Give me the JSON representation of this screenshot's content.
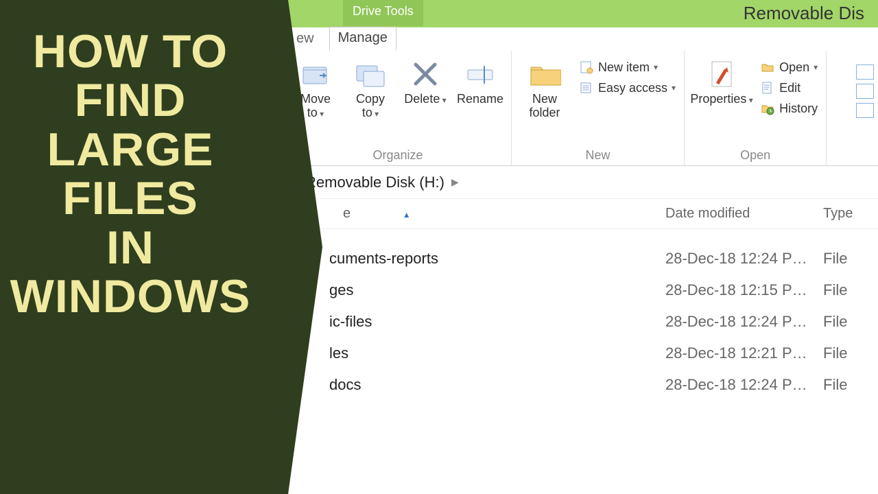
{
  "titlebar": {
    "context_tab": "Drive Tools",
    "window_title": "Removable Dis"
  },
  "tabs": {
    "partial_left": "ew",
    "manage": "Manage"
  },
  "ribbon": {
    "organize": {
      "move_to": "Move\nto",
      "copy_to": "Copy\nto",
      "delete": "Delete",
      "rename": "Rename",
      "group": "Organize"
    },
    "new": {
      "new_folder": "New\nfolder",
      "new_item": "New item",
      "easy_access": "Easy access",
      "group": "New"
    },
    "open": {
      "properties": "Properties",
      "open": "Open",
      "edit": "Edit",
      "history": "History",
      "group": "Open"
    }
  },
  "breadcrumb": {
    "current": "Removable Disk (H:)"
  },
  "columns": {
    "name": "e",
    "date": "Date modified",
    "type": "Type"
  },
  "files": [
    {
      "name": "cuments-reports",
      "date": "28-Dec-18 12:24 P…",
      "type": "File "
    },
    {
      "name": "ges",
      "date": "28-Dec-18 12:15 P…",
      "type": "File "
    },
    {
      "name": "ic-files",
      "date": "28-Dec-18 12:24 P…",
      "type": "File "
    },
    {
      "name": "les",
      "date": "28-Dec-18 12:21 P…",
      "type": "File "
    },
    {
      "name": "docs",
      "date": "28-Dec-18 12:24 P…",
      "type": "File "
    }
  ],
  "overlay": {
    "lines": [
      "HOW TO",
      "FIND",
      "LARGE",
      "FILES",
      "IN",
      "WINDOWS"
    ]
  }
}
